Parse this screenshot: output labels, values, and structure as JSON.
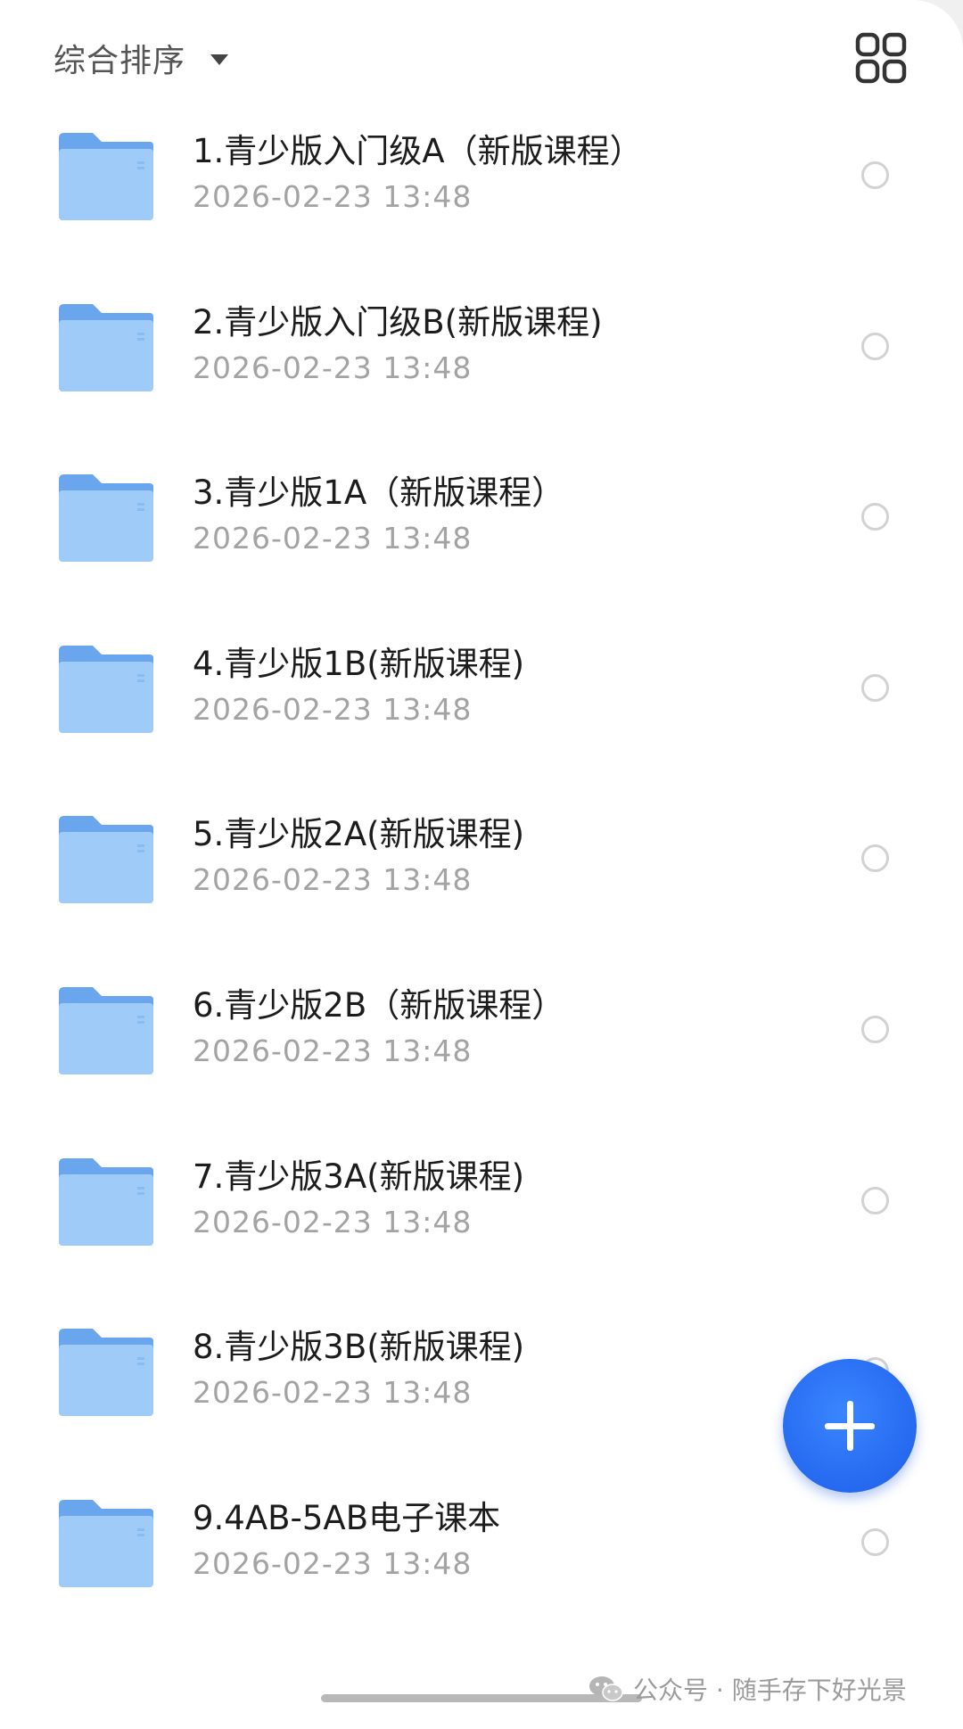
{
  "toolbar": {
    "sort_label": "综合排序",
    "sort_icon": "caret-down-icon",
    "view_toggle_icon": "grid-view-icon"
  },
  "colors": {
    "folder_back": "#6aa6ee",
    "folder_front": "#9ecbf8",
    "fab_blue": "#2a6ff3",
    "date_gray": "#a3a3a3"
  },
  "files": [
    {
      "name": "1.青少版入门级A（新版课程）",
      "date": "2026-02-23 13:48"
    },
    {
      "name": "2.青少版入门级B(新版课程)",
      "date": "2026-02-23 13:48"
    },
    {
      "name": "3.青少版1A（新版课程）",
      "date": "2026-02-23 13:48"
    },
    {
      "name": "4.青少版1B(新版课程)",
      "date": "2026-02-23 13:48"
    },
    {
      "name": "5.青少版2A(新版课程)",
      "date": "2026-02-23 13:48"
    },
    {
      "name": "6.青少版2B（新版课程）",
      "date": "2026-02-23 13:48"
    },
    {
      "name": "7.青少版3A(新版课程)",
      "date": "2026-02-23 13:48"
    },
    {
      "name": "8.青少版3B(新版课程)",
      "date": "2026-02-23 13:48"
    },
    {
      "name": "9.4AB-5AB电子课本",
      "date": "2026-02-23 13:48"
    }
  ],
  "fab": {
    "icon": "plus-icon"
  },
  "watermark": {
    "icon": "wechat-icon",
    "text": "公众号 · 随手存下好光景"
  }
}
